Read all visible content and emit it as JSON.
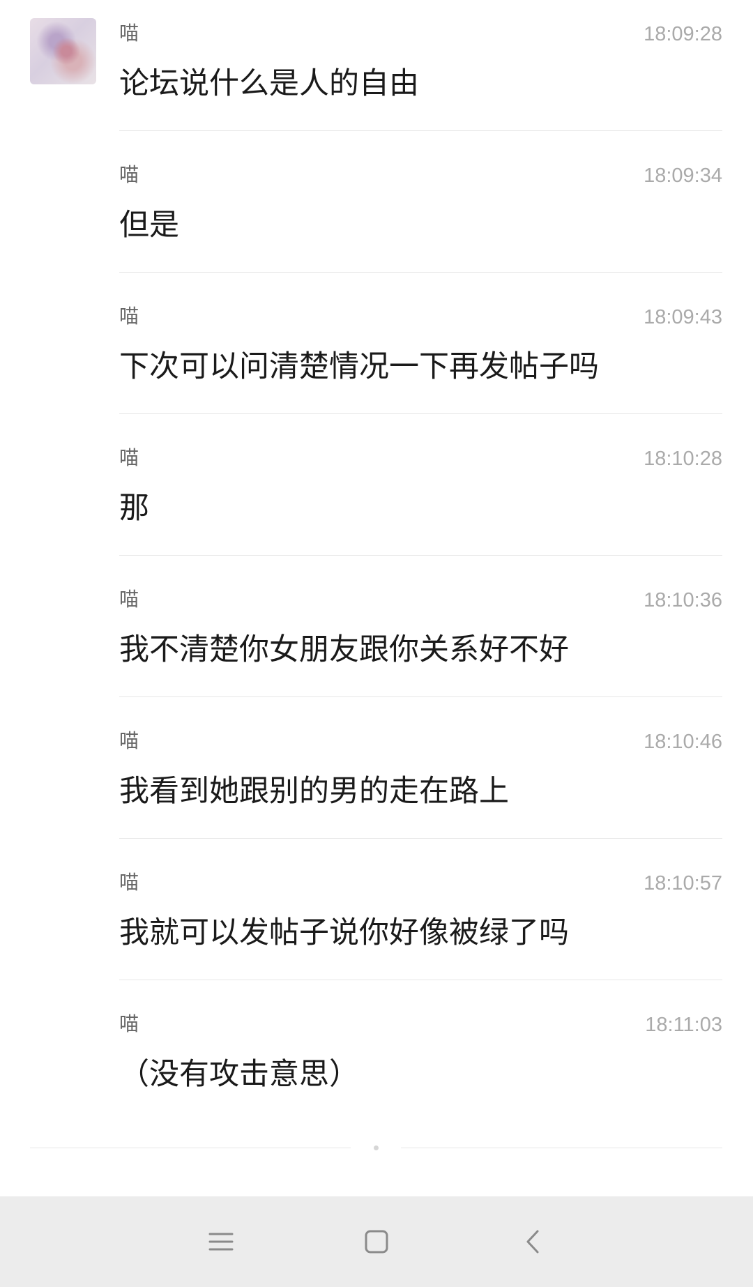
{
  "conversation": {
    "messages": [
      {
        "sender": "喵",
        "time": "18:09:28",
        "text": "论坛说什么是人的自由"
      },
      {
        "sender": "喵",
        "time": "18:09:34",
        "text": "但是"
      },
      {
        "sender": "喵",
        "time": "18:09:43",
        "text": "下次可以问清楚情况一下再发帖子吗"
      },
      {
        "sender": "喵",
        "time": "18:10:28",
        "text": "那"
      },
      {
        "sender": "喵",
        "time": "18:10:36",
        "text": "我不清楚你女朋友跟你关系好不好"
      },
      {
        "sender": "喵",
        "time": "18:10:46",
        "text": "我看到她跟别的男的走在路上"
      },
      {
        "sender": "喵",
        "time": "18:10:57",
        "text": "我就可以发帖子说你好像被绿了吗"
      },
      {
        "sender": "喵",
        "time": "18:11:03",
        "text": "（没有攻击意思）"
      }
    ]
  },
  "nav_bar": {
    "buttons": [
      {
        "icon": "menu-icon"
      },
      {
        "icon": "home-icon"
      },
      {
        "icon": "back-icon"
      }
    ]
  },
  "colors": {
    "sender": "#666666",
    "time": "#aaaaaa",
    "text": "#1a1a1a",
    "divider": "#e6e6e6",
    "nav_background": "#ececec",
    "nav_icon": "#8a8a8a"
  }
}
